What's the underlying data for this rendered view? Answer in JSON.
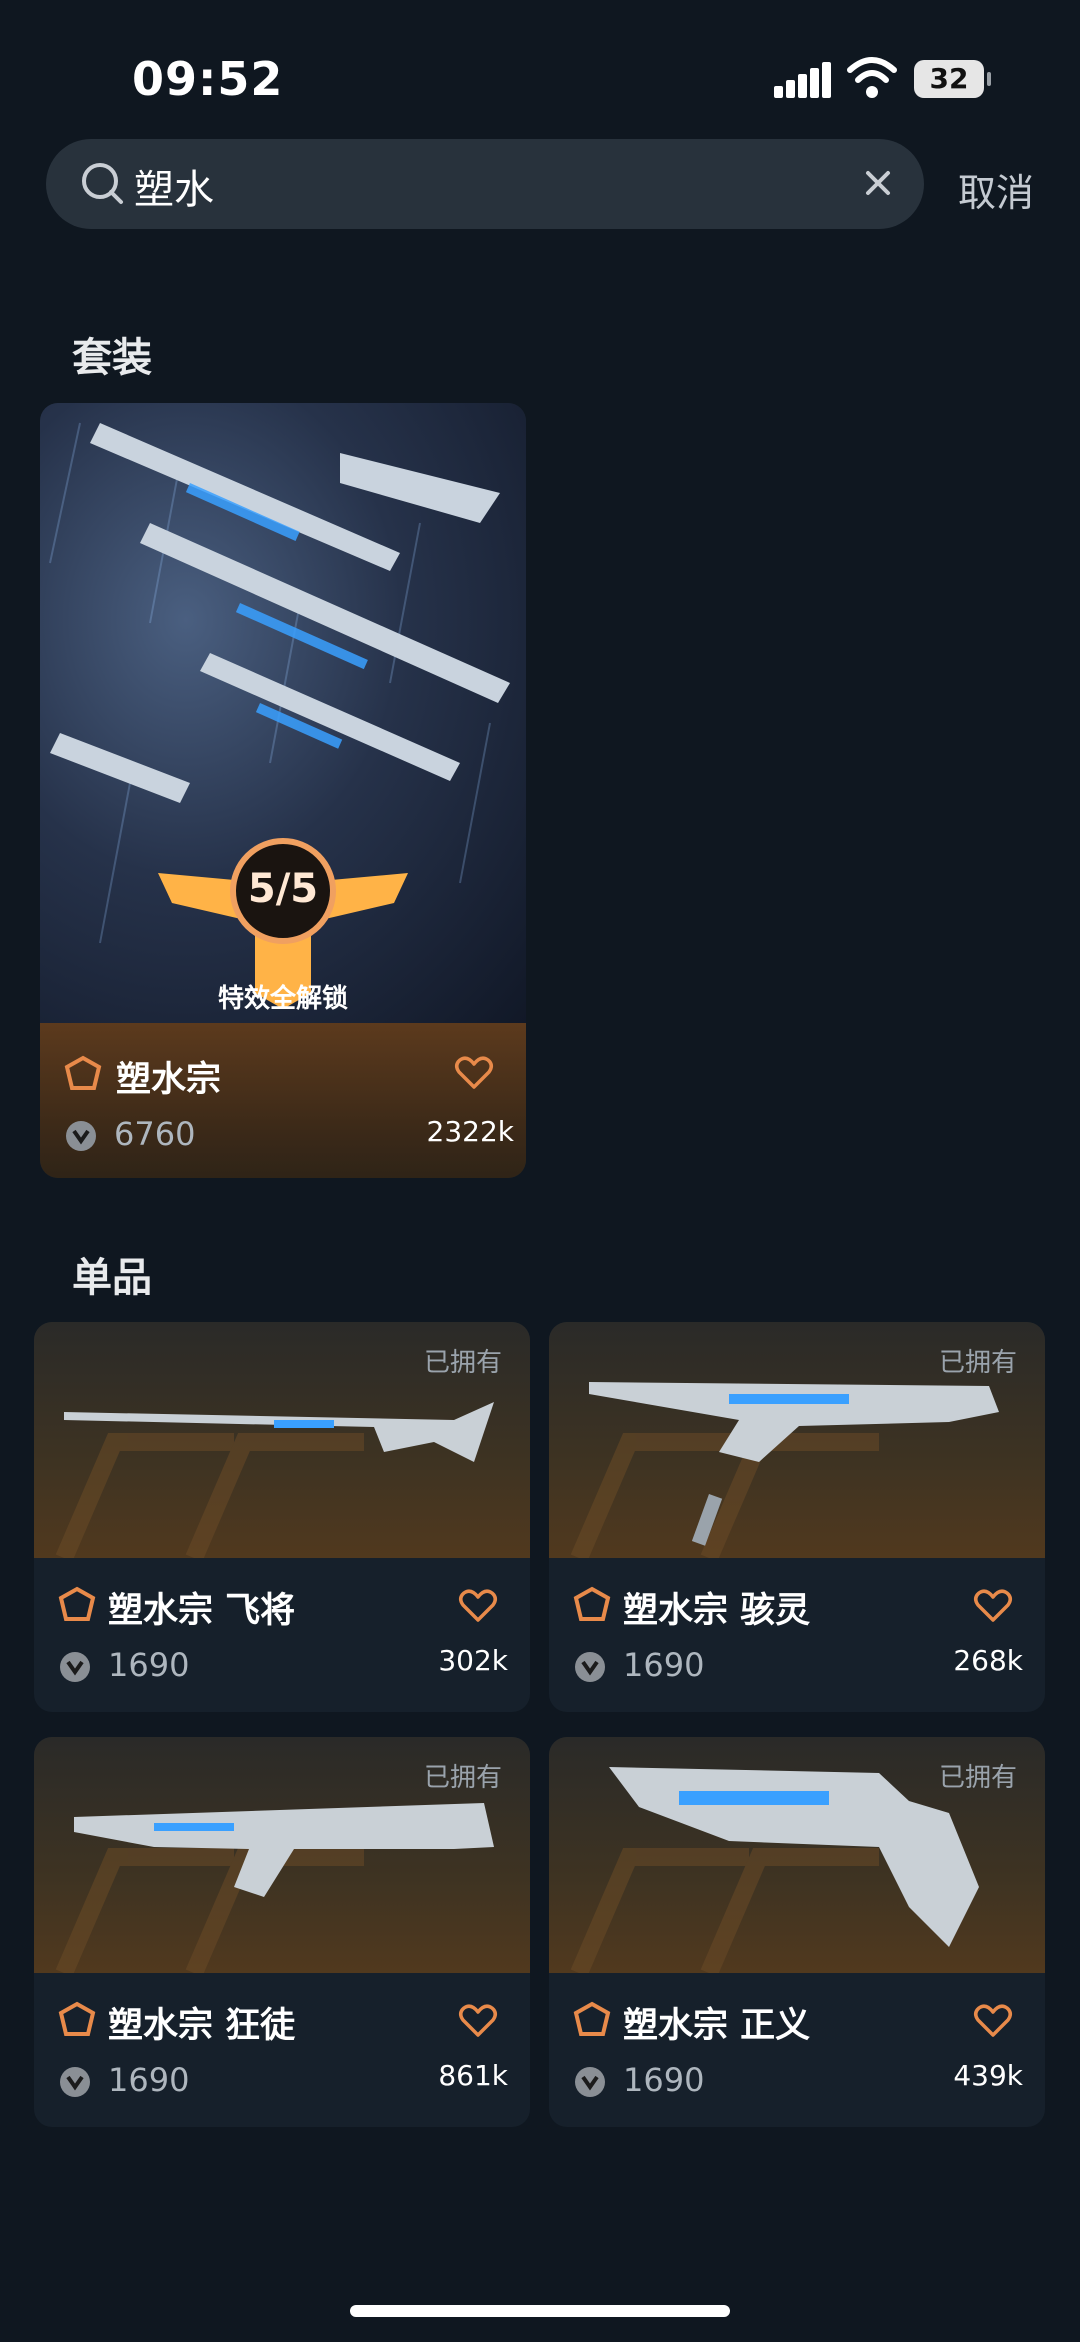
{
  "status": {
    "time": "09:52",
    "battery": "32"
  },
  "search": {
    "value": "塑水",
    "cancel": "取消"
  },
  "sections": {
    "set": "套装",
    "single": "单品"
  },
  "set_card": {
    "badge_score": "5/5",
    "badge_text": "特效全解锁",
    "name": "塑水宗",
    "price": "6760",
    "likes": "2322k"
  },
  "items": [
    {
      "owned": "已拥有",
      "name": "塑水宗 飞将",
      "price": "1690",
      "likes": "302k"
    },
    {
      "owned": "已拥有",
      "name": "塑水宗 骇灵",
      "price": "1690",
      "likes": "268k"
    },
    {
      "owned": "已拥有",
      "name": "塑水宗 狂徒",
      "price": "1690",
      "likes": "861k"
    },
    {
      "owned": "已拥有",
      "name": "塑水宗 正义",
      "price": "1690",
      "likes": "439k"
    }
  ],
  "colors": {
    "accent": "#e88a4a",
    "bg": "#0f1720"
  },
  "icons": {
    "tier": "tier-badge-icon",
    "currency": "vp-currency-icon",
    "like": "heart-icon",
    "search": "search-icon",
    "clear": "close-icon"
  }
}
